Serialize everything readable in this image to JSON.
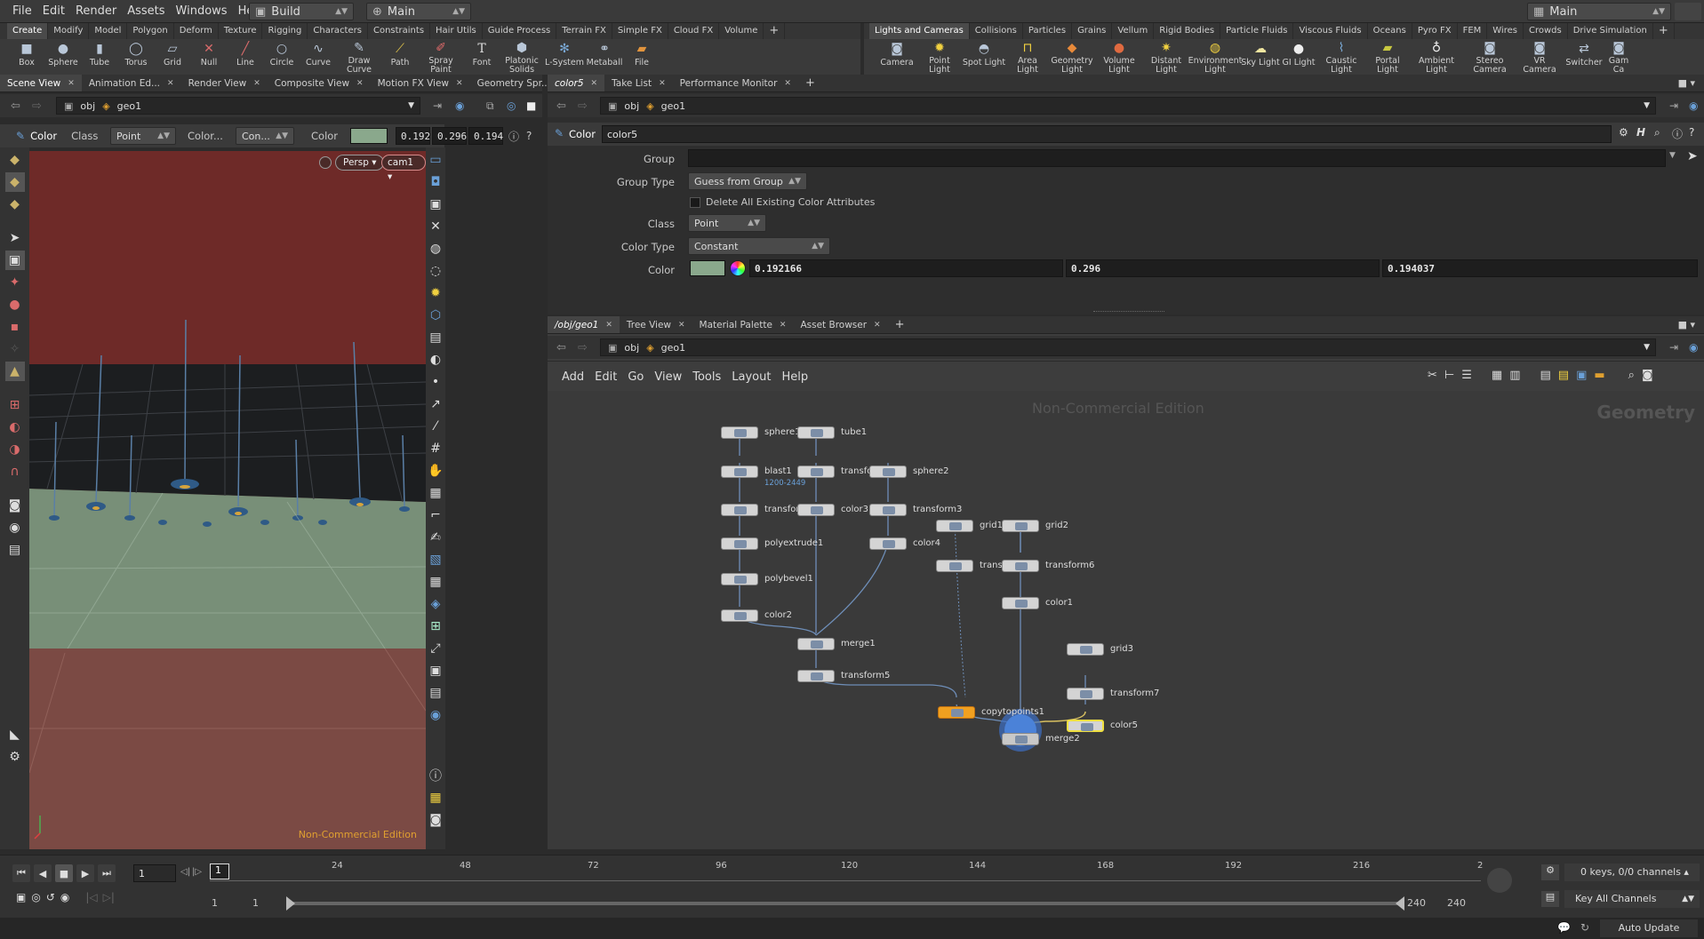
{
  "menubar": {
    "items": [
      "File",
      "Edit",
      "Render",
      "Assets",
      "Windows",
      "Help"
    ],
    "desktop": "Build",
    "context": "Main",
    "right_context": "Main"
  },
  "shelf_left": {
    "tabs": [
      "Create",
      "Modify",
      "Model",
      "Polygon",
      "Deform",
      "Texture",
      "Rigging",
      "Characters",
      "Constraints",
      "Hair Utils",
      "Guide Process",
      "Terrain FX",
      "Simple FX",
      "Cloud FX",
      "Volume"
    ],
    "tools": [
      "Box",
      "Sphere",
      "Tube",
      "Torus",
      "Grid",
      "Null",
      "Line",
      "Circle",
      "Curve",
      "Draw Curve",
      "Path",
      "Spray Paint",
      "Font",
      "Platonic Solids",
      "L-System",
      "Metaball",
      "File"
    ]
  },
  "shelf_right": {
    "tabs": [
      "Lights and Cameras",
      "Collisions",
      "Particles",
      "Grains",
      "Vellum",
      "Rigid Bodies",
      "Particle Fluids",
      "Viscous Fluids",
      "Oceans",
      "Pyro FX",
      "FEM",
      "Wires",
      "Crowds",
      "Drive Simulation"
    ],
    "tools": [
      "Camera",
      "Point Light",
      "Spot Light",
      "Area Light",
      "Geometry Light",
      "Volume Light",
      "Distant Light",
      "Environment Light",
      "Sky Light",
      "GI Light",
      "Caustic Light",
      "Portal Light",
      "Ambient Light",
      "Stereo Camera",
      "VR Camera",
      "Switcher",
      "Gam Ca"
    ]
  },
  "left_pane": {
    "tabs": [
      "Scene View",
      "Animation Ed...",
      "Render View",
      "Composite View",
      "Motion FX View",
      "Geometry Spr..."
    ],
    "path": [
      "obj",
      "geo1"
    ],
    "toolbar": {
      "state": "Color",
      "class_label": "Class",
      "class_value": "Point",
      "color_label": "Color...",
      "con_value": "Con...",
      "color2_label": "Color",
      "r": "0.192",
      "g": "0.296",
      "b": "0.194"
    },
    "view": {
      "persp": "Persp",
      "cam": "cam1",
      "watermark": "Non-Commercial Edition"
    }
  },
  "params": {
    "tabs": [
      "color5",
      "Take List",
      "Performance Monitor"
    ],
    "path": [
      "obj",
      "geo1"
    ],
    "node_type": "Color",
    "node_name": "color5",
    "group_label": "Group",
    "group_value": "",
    "group_type_label": "Group Type",
    "group_type_value": "Guess from Group",
    "delete_label": "Delete All Existing Color Attributes",
    "class_label": "Class",
    "class_value": "Point",
    "color_type_label": "Color Type",
    "color_type_value": "Constant",
    "color_label": "Color",
    "swatch": "#8aa88c",
    "r": "0.192166",
    "g": "0.296",
    "b": "0.194037"
  },
  "network": {
    "tabs": [
      "/obj/geo1",
      "Tree View",
      "Material Palette",
      "Asset Browser"
    ],
    "path": [
      "obj",
      "geo1"
    ],
    "menu": [
      "Add",
      "Edit",
      "Go",
      "View",
      "Tools",
      "Layout",
      "Help"
    ],
    "watermark": "Non-Commercial Edition",
    "context_label": "Geometry",
    "nodes": [
      {
        "name": "sphere1"
      },
      {
        "name": "tube1"
      },
      {
        "name": "blast1",
        "sub": "1200-2449"
      },
      {
        "name": "transform1"
      },
      {
        "name": "sphere2"
      },
      {
        "name": "transform"
      },
      {
        "name": "color3"
      },
      {
        "name": "transform3"
      },
      {
        "name": "grid1"
      },
      {
        "name": "grid2"
      },
      {
        "name": "polyextrude1"
      },
      {
        "name": "color4"
      },
      {
        "name": "transf"
      },
      {
        "name": "transform6"
      },
      {
        "name": "polybevel1"
      },
      {
        "name": "color1"
      },
      {
        "name": "color2"
      },
      {
        "name": "merge1"
      },
      {
        "name": "grid3"
      },
      {
        "name": "transform5"
      },
      {
        "name": "transform7"
      },
      {
        "name": "copytopoints1"
      },
      {
        "name": "color5"
      },
      {
        "name": "merge2"
      }
    ]
  },
  "timeline": {
    "frame": "1",
    "ticks": [
      "24",
      "48",
      "72",
      "96",
      "120",
      "144",
      "168",
      "192",
      "216",
      "2"
    ],
    "start": "1",
    "start2": "1",
    "end": "240",
    "end2": "240",
    "keys": "0 keys, 0/0 channels",
    "key_all": "Key All Channels",
    "auto_update": "Auto Update"
  }
}
